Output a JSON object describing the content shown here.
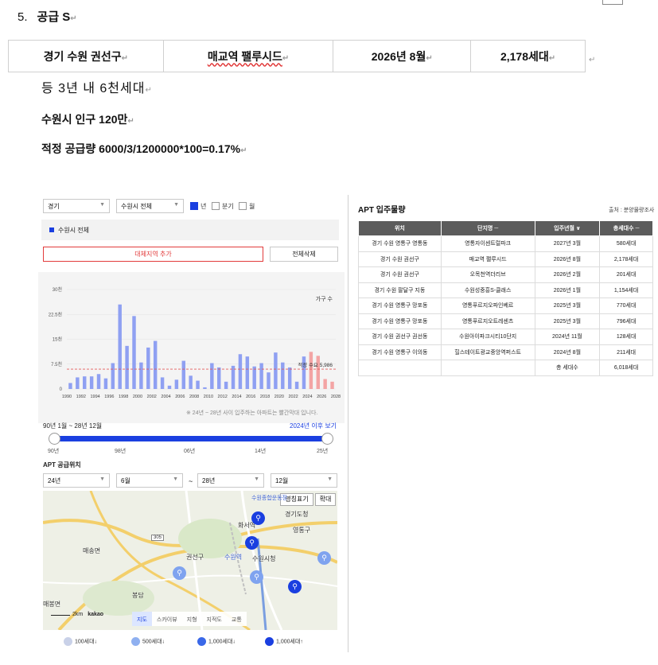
{
  "section": {
    "number": "5.",
    "title": "공급 S"
  },
  "supply_row": [
    "경기 수원 권선구",
    "매교역 팰루시드",
    "2026년 8월",
    "2,178세대"
  ],
  "line1": "등 3년 내 6천세대",
  "line2": "수원시 인구 120만",
  "line3": "적정 공급량 6000/3/1200000*100=0.17%",
  "para_mark": "↵",
  "left_widget": {
    "filters": {
      "province": "경기",
      "city": "수원시 전체",
      "year_label": "년",
      "quarter_label": "분기",
      "month_label": "월"
    },
    "region_item": "수원시 전체",
    "add_region_button": "대체지역 추가",
    "delete_all_button": "전체삭제",
    "note": "※ 24년 ~ 28년 사이 입주하는 아파트는 빨간막대 입니다.",
    "range_label": "90년 1월 ~ 28년 12월",
    "after_2024_link": "2024년 이후 보기",
    "slider_ticks": [
      "90년",
      "98년",
      "06년",
      "14년",
      "25년"
    ],
    "apt_location_title": "APT 공급위치",
    "date_from": {
      "year": "24년",
      "month": "6월"
    },
    "tilde": "~",
    "date_to": {
      "year": "28년",
      "month": "12월"
    },
    "map": {
      "buttons": [
        "명칭표기",
        "확대"
      ],
      "tabs": [
        "지도",
        "스카이뷰",
        "지형",
        "지적도",
        "교통"
      ],
      "scale": "2km",
      "brand": "kakao",
      "places": [
        "수원종합운동장",
        "화서역",
        "경기도청",
        "매송면",
        "권선구",
        "수원역",
        "수원시청",
        "영통구",
        "봉담",
        "매봉면"
      ],
      "road_number": "305"
    },
    "legend": [
      "100세대↓",
      "500세대↓",
      "1,000세대↓",
      "1,000세대↑"
    ]
  },
  "chart_data": {
    "type": "bar",
    "title": "",
    "xlabel": "",
    "ylabel": "가구 수",
    "ylim": [
      0,
      30000
    ],
    "yticks": [
      "0",
      "7.5천",
      "15천",
      "22.5천",
      "30천"
    ],
    "xticks": [
      "1990",
      "1992",
      "1994",
      "1996",
      "1998",
      "2000",
      "2002",
      "2004",
      "2006",
      "2008",
      "2010",
      "2012",
      "2014",
      "2016",
      "2018",
      "2020",
      "2022",
      "2024",
      "2026",
      "2028"
    ],
    "categories": [
      "1990",
      "1991",
      "1992",
      "1993",
      "1994",
      "1995",
      "1996",
      "1997",
      "1998",
      "1999",
      "2000",
      "2001",
      "2002",
      "2003",
      "2004",
      "2005",
      "2006",
      "2007",
      "2008",
      "2009",
      "2010",
      "2011",
      "2012",
      "2013",
      "2014",
      "2015",
      "2016",
      "2017",
      "2018",
      "2019",
      "2020",
      "2021",
      "2022",
      "2023",
      "2024",
      "2025",
      "2026",
      "2027"
    ],
    "values": [
      1800,
      3500,
      3800,
      3800,
      4500,
      3200,
      7800,
      25500,
      13000,
      22000,
      8000,
      12500,
      14500,
      3500,
      1000,
      2800,
      8500,
      4000,
      2500,
      500,
      7800,
      6500,
      2200,
      7000,
      10500,
      9800,
      6800,
      7800,
      5000,
      11000,
      8000,
      6500,
      2200,
      9800,
      11200,
      10000,
      3000,
      2200
    ],
    "highlight_from": "2024",
    "highlight_color": "#f3a4a4",
    "bar_color": "#8fa0f2",
    "reference_line": {
      "label": "적정 수요 5,986",
      "value": 5986,
      "color": "#e25b5b"
    },
    "legend_label": "가구 수"
  },
  "right_widget": {
    "title": "APT 입주물량",
    "source": "출처 : 분양물량조사",
    "headers": [
      "위치",
      "단지명 ─",
      "입주년월 ∨",
      "총세대수 ─"
    ],
    "rows": [
      [
        "경기 수원 영통구 영통동",
        "영통자이센트럴파크",
        "2027년 3월",
        "580세대"
      ],
      [
        "경기 수원 권선구",
        "매교역 팰루시드",
        "2026년 8월",
        "2,178세대"
      ],
      [
        "경기 수원 권선구",
        "오목천역더리브",
        "2026년 2월",
        "201세대"
      ],
      [
        "경기 수원 팔달구 지동",
        "수원성중흥S-클래스",
        "2026년 1월",
        "1,154세대"
      ],
      [
        "경기 수원 영통구 망포동",
        "영통푸르지오파인베르",
        "2025년 3월",
        "770세대"
      ],
      [
        "경기 수원 영통구 망포동",
        "영통푸르지오트레센츠",
        "2025년 3월",
        "796세대"
      ],
      [
        "경기 수원 권선구 권선동",
        "수원아이파크시티10단지",
        "2024년 11월",
        "128세대"
      ],
      [
        "경기 수원 영통구 이의동",
        "힐스테이트광교중앙역퍼스트",
        "2024년 8월",
        "211세대"
      ]
    ],
    "total_label": "총 세대수",
    "total_value": "6,018세대"
  }
}
